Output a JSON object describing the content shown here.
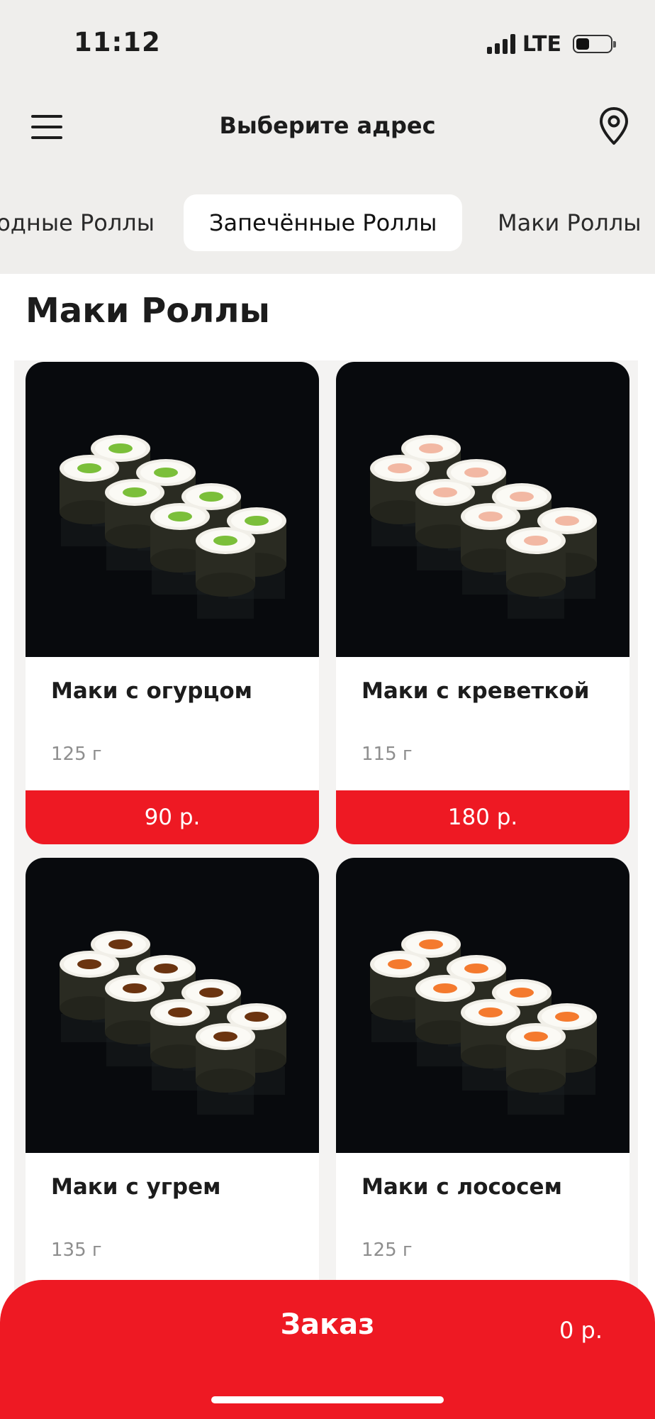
{
  "status_bar": {
    "time": "11:12",
    "network": "LTE"
  },
  "header": {
    "address_label": "Выберите адрес",
    "menu_icon": "hamburger-menu-icon",
    "location_icon": "location-pin-icon"
  },
  "category_tabs": [
    {
      "label": "Холодные Роллы",
      "active": false
    },
    {
      "label": "Запечённые Роллы",
      "active": true
    },
    {
      "label": "Маки Роллы",
      "active": false
    }
  ],
  "section": {
    "title": "Маки Роллы"
  },
  "products": [
    {
      "name": "Маки с огурцом",
      "weight": "125 г",
      "price": "90 р.",
      "filling_color": "#7bbf3a"
    },
    {
      "name": "Маки с креветкой",
      "weight": "115 г",
      "price": "180 р.",
      "filling_color": "#f2b8a3"
    },
    {
      "name": "Маки с угрем",
      "weight": "135 г",
      "price": "",
      "filling_color": "#6b3410"
    },
    {
      "name": "Маки с лососем",
      "weight": "125 г",
      "price": "",
      "filling_color": "#f47a2e"
    }
  ],
  "order_bar": {
    "label": "Заказ",
    "total": "0 р."
  },
  "colors": {
    "accent": "#ee1923",
    "header_bg": "#efeeec",
    "image_bg": "#080a0d"
  }
}
